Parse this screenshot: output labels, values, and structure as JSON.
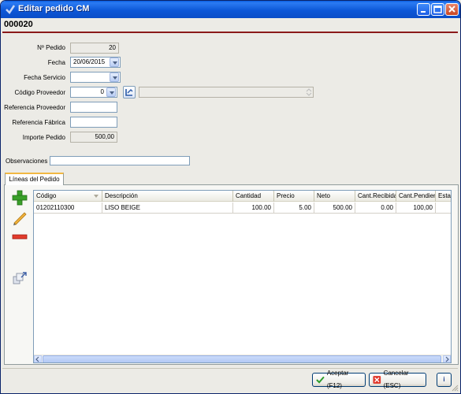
{
  "window": {
    "title": "Editar pedido CM",
    "icon": "app-check-icon"
  },
  "header": {
    "order_code": "000020"
  },
  "form": {
    "num_pedido": {
      "label": "Nº Pedido",
      "value": "20"
    },
    "fecha": {
      "label": "Fecha",
      "value": "20/06/2015"
    },
    "fecha_servicio": {
      "label": "Fecha Servicio",
      "value": ""
    },
    "codigo_proveedor": {
      "label": "Código Proveedor",
      "value": "0",
      "name_value": ""
    },
    "referencia_proveedor": {
      "label": "Referencia Proveedor",
      "value": ""
    },
    "referencia_fabrica": {
      "label": "Referencia Fábrica",
      "value": ""
    },
    "importe_pedido": {
      "label": "Importe Pedido",
      "value": "500,00"
    },
    "observaciones": {
      "label": "Observaciones",
      "value": ""
    }
  },
  "tabs": [
    {
      "label": "Líneas del Pedido",
      "active": true
    }
  ],
  "grid": {
    "columns": [
      "Código",
      "Descripción",
      "Cantidad",
      "Precio",
      "Neto",
      "Cant.Recibida",
      "Cant.Pendiente",
      "Estado"
    ],
    "rows": [
      [
        "01202110300",
        "LISO BEIGE",
        "100.00",
        "5.00",
        "500.00",
        "0.00",
        "100,00",
        ""
      ]
    ]
  },
  "side_tools": [
    "add-line-icon",
    "edit-line-icon",
    "delete-line-icon",
    "transfer-icon"
  ],
  "footer": {
    "accept_label": "Aceptar (F12)",
    "cancel_label": "Cancelar (ESC)",
    "info_label": "i"
  },
  "colors": {
    "titlebar": "#0a5fe3",
    "header_rule": "#8b1a1a",
    "accent_tab": "#f1b843"
  }
}
